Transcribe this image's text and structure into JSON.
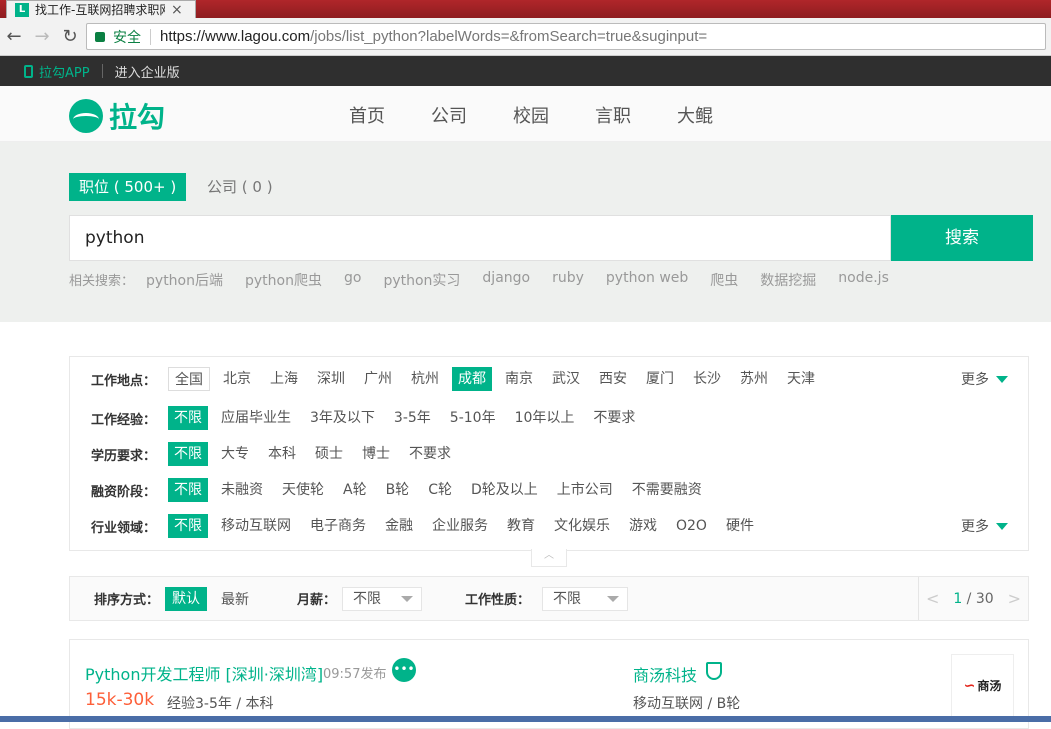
{
  "browser": {
    "tab_title": "找工作-互联网招聘求职网",
    "tab_favicon": "L",
    "secure_label": "安全",
    "url_host": "https://www.lagou.com",
    "url_path": "/jobs/list_python?labelWords=&fromSearch=true&suginput="
  },
  "topstrip": {
    "app_label": "拉勾APP",
    "enterprise_label": "进入企业版"
  },
  "header": {
    "logo_text": "拉勾",
    "nav": [
      "首页",
      "公司",
      "校园",
      "言职",
      "大鲲"
    ]
  },
  "search": {
    "tab_jobs": "职位 ( 500+ )",
    "tab_company": "公司 ( 0 )",
    "query": "python",
    "button": "搜索",
    "related_label": "相关搜索：",
    "related": [
      "python后端",
      "python爬虫",
      "go",
      "python实习",
      "django",
      "ruby",
      "python web",
      "爬虫",
      "数据挖掘",
      "node.js"
    ]
  },
  "filters": {
    "more_label": "更多",
    "location": {
      "label": "工作地点：",
      "options": [
        "全国",
        "北京",
        "上海",
        "深圳",
        "广州",
        "杭州",
        "成都",
        "南京",
        "武汉",
        "西安",
        "厦门",
        "长沙",
        "苏州",
        "天津"
      ],
      "selected": "成都"
    },
    "experience": {
      "label": "工作经验：",
      "options": [
        "不限",
        "应届毕业生",
        "3年及以下",
        "3-5年",
        "5-10年",
        "10年以上",
        "不要求"
      ]
    },
    "education": {
      "label": "学历要求：",
      "options": [
        "不限",
        "大专",
        "本科",
        "硕士",
        "博士",
        "不要求"
      ]
    },
    "funding": {
      "label": "融资阶段：",
      "options": [
        "不限",
        "未融资",
        "天使轮",
        "A轮",
        "B轮",
        "C轮",
        "D轮及以上",
        "上市公司",
        "不需要融资"
      ]
    },
    "industry": {
      "label": "行业领域：",
      "options": [
        "不限",
        "移动互联网",
        "电子商务",
        "金融",
        "企业服务",
        "教育",
        "文化娱乐",
        "游戏",
        "O2O",
        "硬件"
      ]
    }
  },
  "sortbar": {
    "sort_label": "排序方式：",
    "sort_default": "默认",
    "sort_new": "最新",
    "salary_label": "月薪：",
    "salary_value": "不限",
    "nature_label": "工作性质：",
    "nature_value": "不限",
    "page_current": "1",
    "page_total": "30"
  },
  "job": {
    "title": "Python开发工程师 [深圳·深圳湾]",
    "time": "09:57发布",
    "salary": "15k-30k",
    "requirements": "经验3-5年 / 本科",
    "company": "商汤科技",
    "company_info": "移动互联网 / B轮",
    "logo_text": "商汤"
  },
  "colors": {
    "brand": "#00b38a",
    "salary": "#fd5f39"
  }
}
